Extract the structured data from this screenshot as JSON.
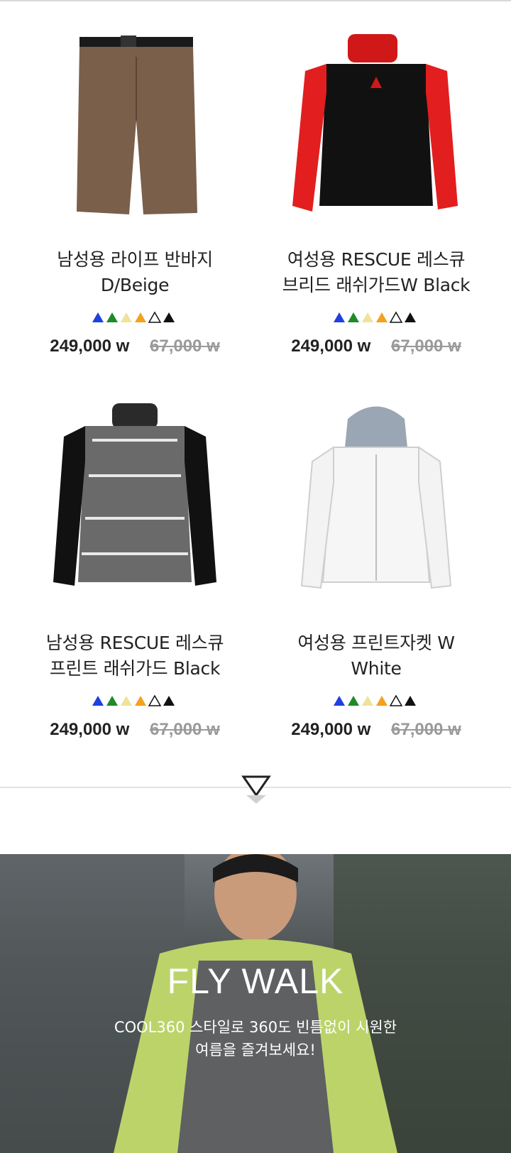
{
  "products": [
    {
      "name_line1": "남성용 라이프 반바지",
      "name_line2": "D/Beige",
      "price": "249,000 w",
      "original_price": "67,000 w",
      "icon": "shorts-image"
    },
    {
      "name_line1": "여성용 RESCUE 레스큐",
      "name_line2": "브리드 래쉬가드W Black",
      "price": "249,000 w",
      "original_price": "67,000 w",
      "icon": "rashguard-image"
    },
    {
      "name_line1": "남성용 RESCUE 레스큐",
      "name_line2": "프린트 래쉬가드 Black",
      "price": "249,000 w",
      "original_price": "67,000 w",
      "icon": "print-rashguard-image"
    },
    {
      "name_line1": "여성용 프린트자켓 W",
      "name_line2": "White",
      "price": "249,000 w",
      "original_price": "67,000 w",
      "icon": "print-jacket-image"
    }
  ],
  "swatch_colors": [
    "#1f3fe0",
    "#1e8a2a",
    "#efe39a",
    "#f4a11c",
    "#ffffff",
    "#111111"
  ],
  "more_icon": "down-triangle-icon",
  "banner": {
    "title": "FLY WALK",
    "subtitle_line1": "COOL360 스타일로 360도 빈틈없이 시원한",
    "subtitle_line2": "여름을 즐겨보세요!"
  }
}
